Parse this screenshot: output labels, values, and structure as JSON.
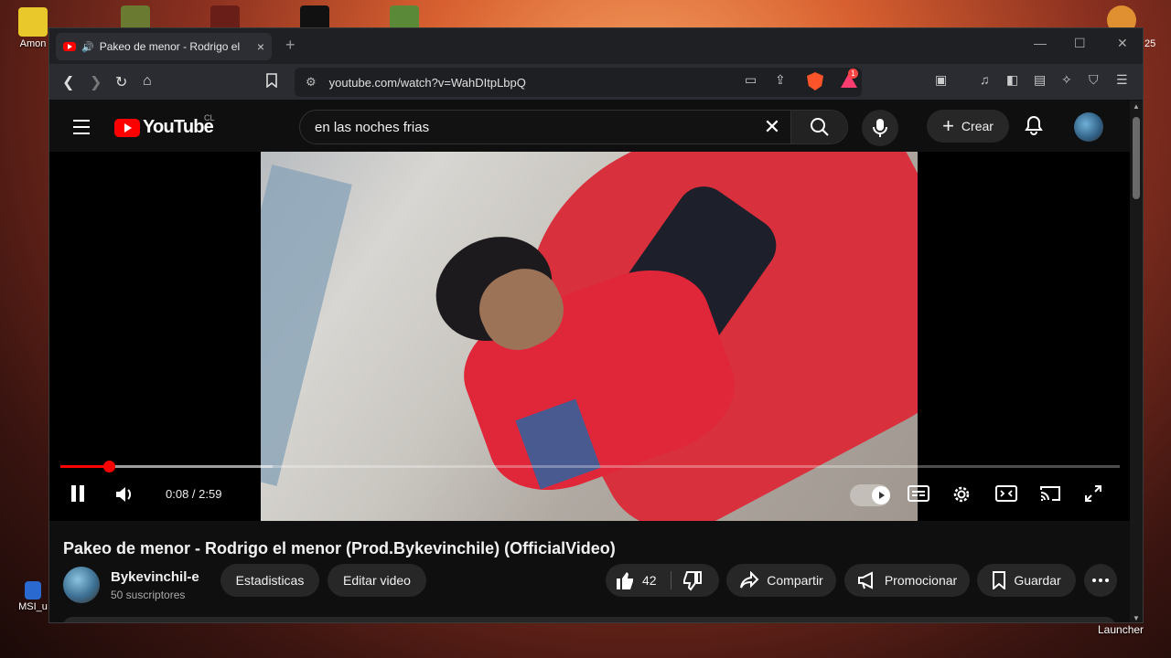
{
  "desktop": {
    "icons": [
      {
        "label": "Amon"
      },
      {
        "label": ""
      },
      {
        "label": ""
      },
      {
        "label": ""
      },
      {
        "label": ""
      },
      {
        "label": "MSI_u"
      }
    ],
    "right_labels": {
      "launcher": "Launcher",
      "year_fragment": "25"
    }
  },
  "browser": {
    "tab": {
      "title": "Pakeo de menor - Rodrigo el",
      "close": "×"
    },
    "newtab": "+",
    "window_controls": {
      "minimize": "—",
      "maximize": "☐",
      "close": "✕"
    },
    "url": "youtube.com/watch?v=WahDItpLbpQ",
    "rewards_badge": "1"
  },
  "youtube": {
    "logo_text": "YouTube",
    "country": "CL",
    "search_query": "en las noches frias",
    "create_label": "Crear",
    "player": {
      "time": "0:08 / 2:59",
      "progress_fraction": 0.046,
      "buffered_fraction": 0.2
    },
    "video": {
      "title": "Pakeo de menor - Rodrigo el menor (Prod.Bykevinchile) (OfficialVideo)",
      "channel": "Bykevinchil-e",
      "subscribers": "50 suscriptores",
      "buttons": {
        "stats": "Estadisticas",
        "edit": "Editar video",
        "likes": "42",
        "share": "Compartir",
        "promote": "Promocionar",
        "save": "Guardar"
      }
    }
  },
  "colors": {
    "accent": "#ff0000",
    "chip": "#272727",
    "bg": "#0f0f0f"
  }
}
